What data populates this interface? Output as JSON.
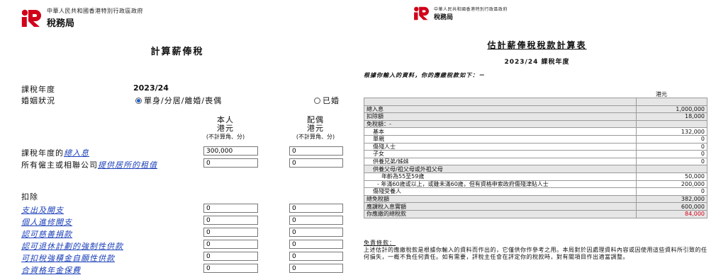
{
  "left": {
    "logo": {
      "line1": "中華人民共和國香港特別行政區政府",
      "line2": "稅務局"
    },
    "title": "計算薪俸稅",
    "year_label": "課稅年度",
    "year_value": "2023/24",
    "marital_label": "婚姻狀況",
    "marital_option1": "單身/分居/離婚/喪偶",
    "marital_option2": "已婚",
    "col_self": {
      "line1": "本人",
      "line2": "港元",
      "line3": "(不計算角、分)"
    },
    "col_spouse": {
      "line1": "配偶",
      "line2": "港元",
      "line3": "(不計算角、分)"
    },
    "income_label_pre": "課稅年度的",
    "income_label_link": "總入息",
    "income_self": "300,000",
    "income_spouse": "0",
    "housing_label_pre": "所有僱主或相聯公司",
    "housing_label_link": "提供居所的租值",
    "housing_self": "0",
    "housing_spouse": "0",
    "deductions_label": "扣除",
    "deductions": [
      {
        "label": "支出及開支",
        "self": "0",
        "spouse": "0"
      },
      {
        "label": "個人進修開支",
        "self": "0",
        "spouse": "0"
      },
      {
        "label": "認可慈善捐款",
        "self": "0",
        "spouse": "0"
      },
      {
        "label": "認可退休計劃的強制性供款",
        "self": "0",
        "spouse": "0"
      },
      {
        "label": "可扣稅強積金自願性供款",
        "self": "0",
        "spouse": "0"
      },
      {
        "label": "合資格年金保費",
        "self": "0",
        "spouse": "0"
      }
    ]
  },
  "right": {
    "logo": {
      "line1": "中華人民共和國香港特別行政區政府",
      "line2": "稅務局"
    },
    "title": "估計薪俸稅稅款計算表",
    "subtitle": "2023/24 課稅年度",
    "note": "根據你輸入的資料，你的應繳稅款如下：－",
    "unit": "港元",
    "rows": [
      {
        "label": "",
        "value": ""
      },
      {
        "label": "總入息",
        "value": "1,000,000"
      },
      {
        "label": "扣除額",
        "value": "18,000"
      },
      {
        "label": "免稅額：-",
        "value": ""
      },
      {
        "label": "基本",
        "value": "132,000"
      },
      {
        "label": "單親",
        "value": "0"
      },
      {
        "label": "傷殘人士",
        "value": "0"
      },
      {
        "label": "子女",
        "value": "0"
      },
      {
        "label": "供養兄弟/姊妹",
        "value": "0"
      },
      {
        "label": "供養父母/祖父母或外祖父母",
        "value": ""
      },
      {
        "label": "年齡為55至59歲",
        "value": "50,000"
      },
      {
        "label": "- 年滿60歲或以上，或雖未滿60歲，但有資格申索政府傷殘津貼人士",
        "value": "200,000"
      },
      {
        "label": "傷殘受養人",
        "value": "0"
      },
      {
        "label": "總免稅額",
        "value": "382,000"
      },
      {
        "label": "應課稅入息實額",
        "value": "600,000"
      },
      {
        "label": "你應繳的總稅款",
        "value": "84,000"
      }
    ],
    "disclaimer_head": "免責條款：",
    "disclaimer_body": "上述估計的應繳稅款是根據你輸入的資料而作出的，它僅供你作參考之用。本局對於因處理資料內容或因使用這些資料所引致的任何損失，一概不負任何責任。如有需要，評稅主任會在評定你的稅款時，對有關項目作出適當調整。",
    "colors": {
      "brand_red": "#d0021b",
      "link_blue": "#1a3fb8",
      "shade": "#e6e6e6"
    }
  }
}
